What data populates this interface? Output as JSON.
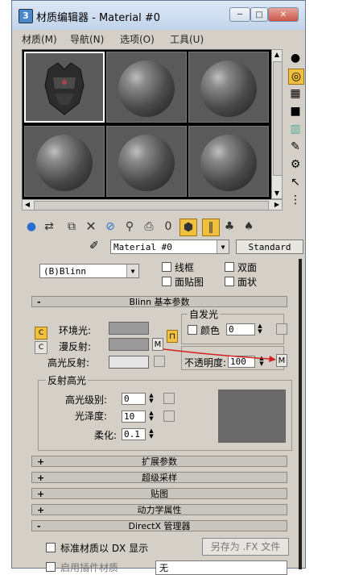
{
  "window": {
    "title": "材质编辑器 - Material #0",
    "app_icon": "3"
  },
  "window_buttons": [
    "─",
    "□",
    "✕"
  ],
  "menu": [
    "材质(M)",
    "导航(N)",
    "选项(O)",
    "工具(U)"
  ],
  "material": {
    "name": "Material #0",
    "type": "Standard"
  },
  "shader": {
    "selected": "(B)Blinn",
    "options": [
      "线框",
      "双面",
      "面贴图",
      "面状"
    ]
  },
  "rollouts": {
    "blinn_basic": "Blinn 基本参数",
    "extended": "扩展参数",
    "supersampling": "超级采样",
    "maps": "贴图",
    "dynamics": "动力学属性",
    "directx": "DirectX 管理器"
  },
  "rollout_signs": {
    "open": "-",
    "closed": "+"
  },
  "basic": {
    "ambient": "环境光:",
    "diffuse": "漫反射:",
    "specular": "高光反射:",
    "m_label": "M",
    "lock_icon": "lock-icon"
  },
  "self_illum": {
    "title": "自发光",
    "color_label": "颜色",
    "value": "0"
  },
  "opacity": {
    "label": "不透明度:",
    "value": "100"
  },
  "specular_highlights": {
    "title": "反射高光",
    "level_label": "高光级别:",
    "level_value": "0",
    "gloss_label": "光泽度:",
    "gloss_value": "10",
    "soften_label": "柔化:",
    "soften_value": "0.1"
  },
  "directx": {
    "checkbox_label": "标准材质以 DX 显示",
    "save_button": "另存为 .FX 文件"
  },
  "bottom_partial": {
    "select_value": "无",
    "label": "启用插件材质"
  },
  "colors": {
    "ambient": "#9a9a9a",
    "diffuse": "#9a9a9a",
    "specular": "#e6e6e6",
    "highlight_preview": "#6a6a6a",
    "red_arrow": "#d42020"
  }
}
